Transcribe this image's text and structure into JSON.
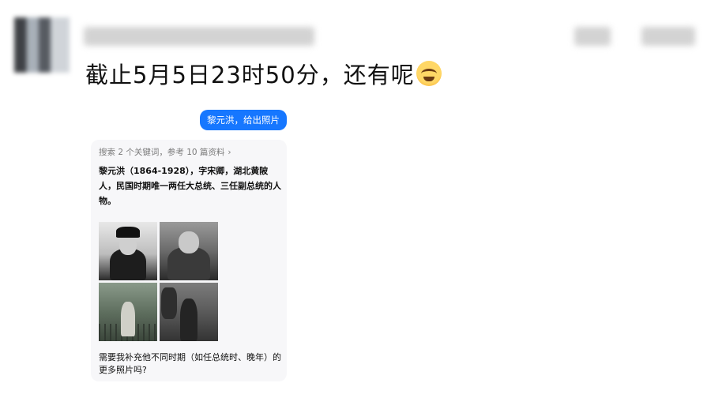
{
  "post": {
    "text": "截止5月5日23时50分，还有呢",
    "emoji_icon": "crying-laughing-face-icon"
  },
  "chat": {
    "user_message": "黎元洪，给出照片",
    "ai": {
      "search_summary": "搜索 2 个关键词，参考 10 篇资料",
      "chevron": "›",
      "answer": "黎元洪（1864-1928），字宋卿，湖北黄陂人，民国时期唯一两任大总统、三任副总统的人物。",
      "followup": "需要我补充他不同时期（如任总统时、晚年）的更多照片吗?"
    }
  },
  "colors": {
    "accent": "#1677ff",
    "card_bg": "#f7f7f9"
  }
}
